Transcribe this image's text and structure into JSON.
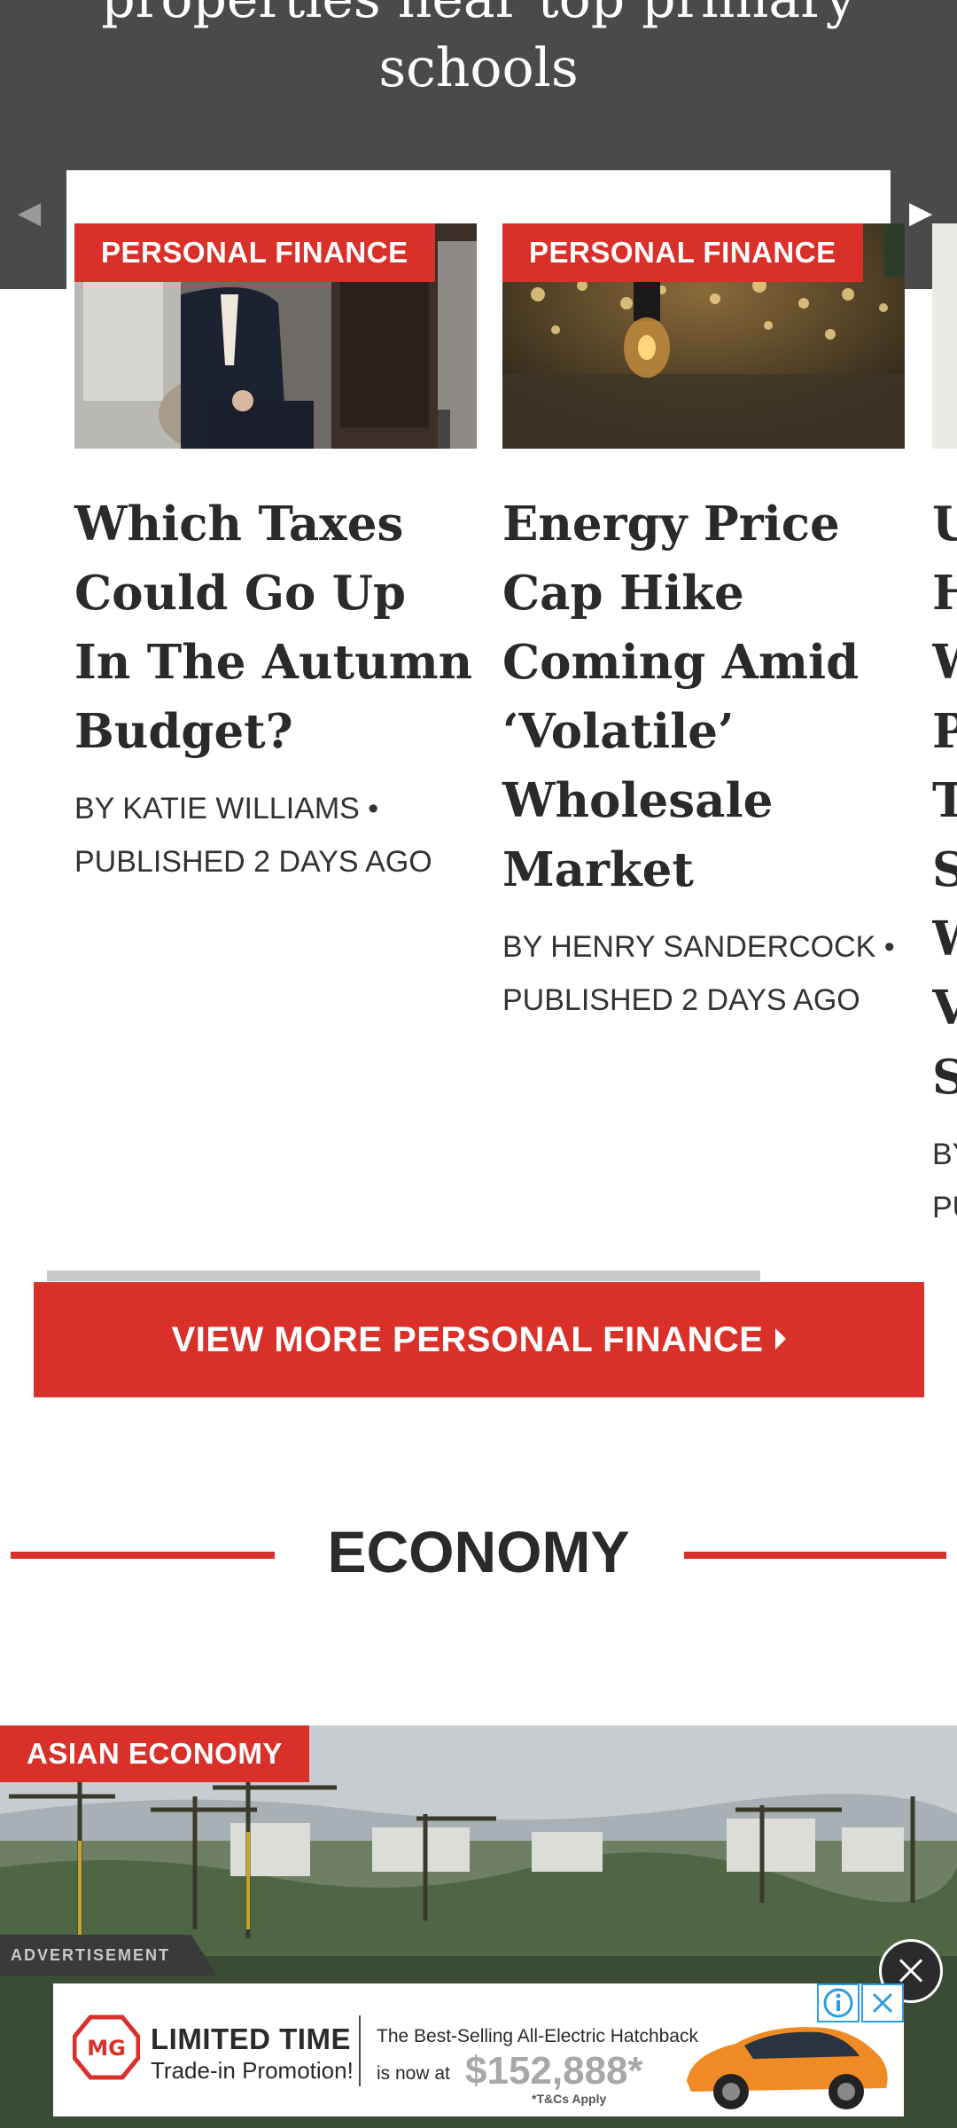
{
  "top_banner": {
    "title_line1": "properties near top primary",
    "title_line2": "schools",
    "prev_arrow": "◀",
    "next_arrow": "▶"
  },
  "cards": [
    {
      "tag": "PERSONAL FINANCE",
      "title": "Which Taxes Could Go Up In The Autumn Budget?",
      "byline": "BY KATIE WILLIAMS • PUBLISHED 2 DAYS AGO"
    },
    {
      "tag": "PERSONAL FINANCE",
      "title": "Energy Price Cap Hike Coming Amid ‘Volatile’ Wholesale Market",
      "byline": "BY HENRY SANDERCOCK • PUBLISHED 2 DAYS AGO"
    }
  ],
  "partial_card": {
    "title_letters": [
      "U",
      "H",
      "W",
      "P",
      "T",
      "S",
      "W",
      "V",
      "S"
    ],
    "byline_lines": [
      "BY",
      "PU"
    ]
  },
  "view_more": {
    "label": "VIEW MORE PERSONAL FINANCE"
  },
  "economy": {
    "section_title": "ECONOMY",
    "hero_tag": "ASIAN ECONOMY"
  },
  "ad": {
    "label": "ADVERTISEMENT",
    "headline": "LIMITED TIME",
    "subhead": "Trade-in Promotion!",
    "best_selling": "The Best-Selling All-Electric Hatchback",
    "now_at": "is now at",
    "price": "$152,888*",
    "terms": "*T&Cs Apply",
    "brand_logo_icon": "mg-logo-icon",
    "car_image": "orange-hatchback-car"
  },
  "colors": {
    "brand_red": "#d9302a",
    "dark_banner": "#4a4a4d",
    "title_text": "#2a2a2a"
  }
}
